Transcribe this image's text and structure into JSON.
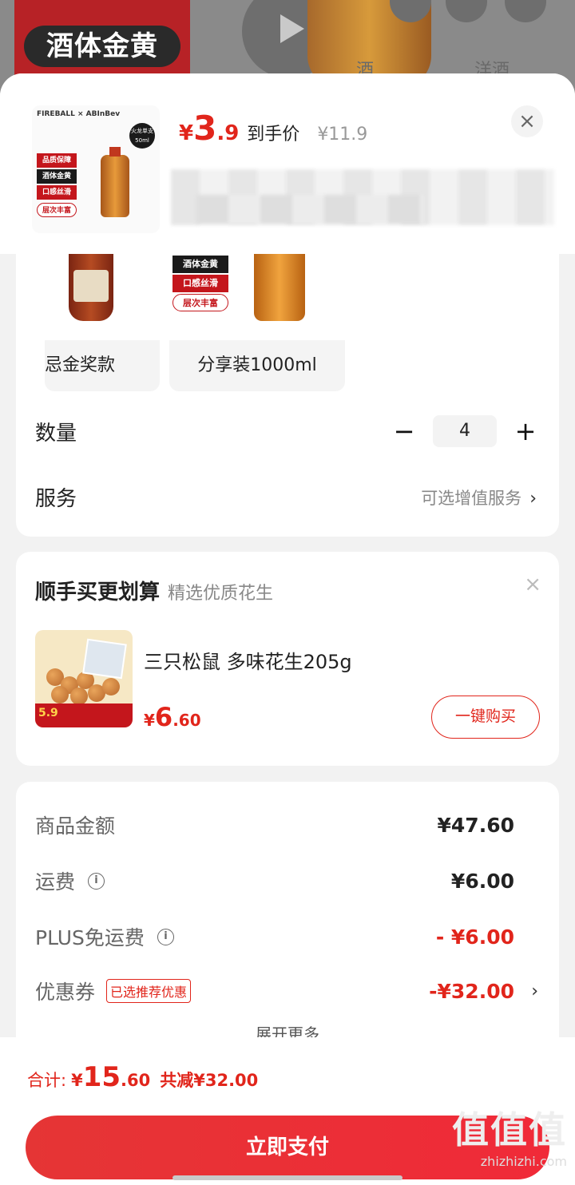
{
  "background": {
    "badge": "酒体金黄",
    "label_left": "酒",
    "label_right": "洋酒"
  },
  "header": {
    "thumb_tags": [
      "品质保障",
      "酒体金黄",
      "口感丝滑",
      "层次丰富"
    ],
    "thumb_ml": "火龙单支50ml",
    "price_symbol": "¥",
    "price_int": "3",
    "price_dec": ".9",
    "price_label": "到手价",
    "original_price": "¥11.9",
    "close_icon": "close-icon"
  },
  "variants": [
    {
      "label": "忌金奖款",
      "tags": []
    },
    {
      "label": "分享装1000ml",
      "tags": [
        "酒体金黄",
        "口感丝滑",
        "层次丰富"
      ]
    }
  ],
  "quantity": {
    "label": "数量",
    "minus": "−",
    "value": "4",
    "plus": "+"
  },
  "service": {
    "label": "服务",
    "hint": "可选增值服务",
    "chevron": "›"
  },
  "combo": {
    "title": "顺手买更划算",
    "subtitle": "精选优质花生",
    "close": "×",
    "product_name": "三只松鼠 多味花生205g",
    "product_badge": "5.9",
    "price_symbol": "¥",
    "price_int": "6",
    "price_dec": ".60",
    "buy_label": "一键购买"
  },
  "summary": {
    "rows": [
      {
        "key": "商品金额",
        "value": "¥47.60"
      },
      {
        "key": "运费",
        "value": "¥6.00"
      },
      {
        "key": "PLUS免运费",
        "value": "- ¥6.00"
      },
      {
        "key": "优惠券",
        "tag": "已选推荐优惠",
        "value": "-¥32.00"
      }
    ],
    "expand": "展开更多"
  },
  "bottom": {
    "total_label": "合计:",
    "total_symbol": "¥",
    "total_int": "15",
    "total_dec": ".60",
    "saving": "共减¥32.00",
    "pay_label": "立即支付"
  },
  "watermark": {
    "logo": "值值值",
    "site": "zhizhizhi.com"
  },
  "colors": {
    "accent": "#e1251b",
    "pay_button": "#e53535"
  }
}
